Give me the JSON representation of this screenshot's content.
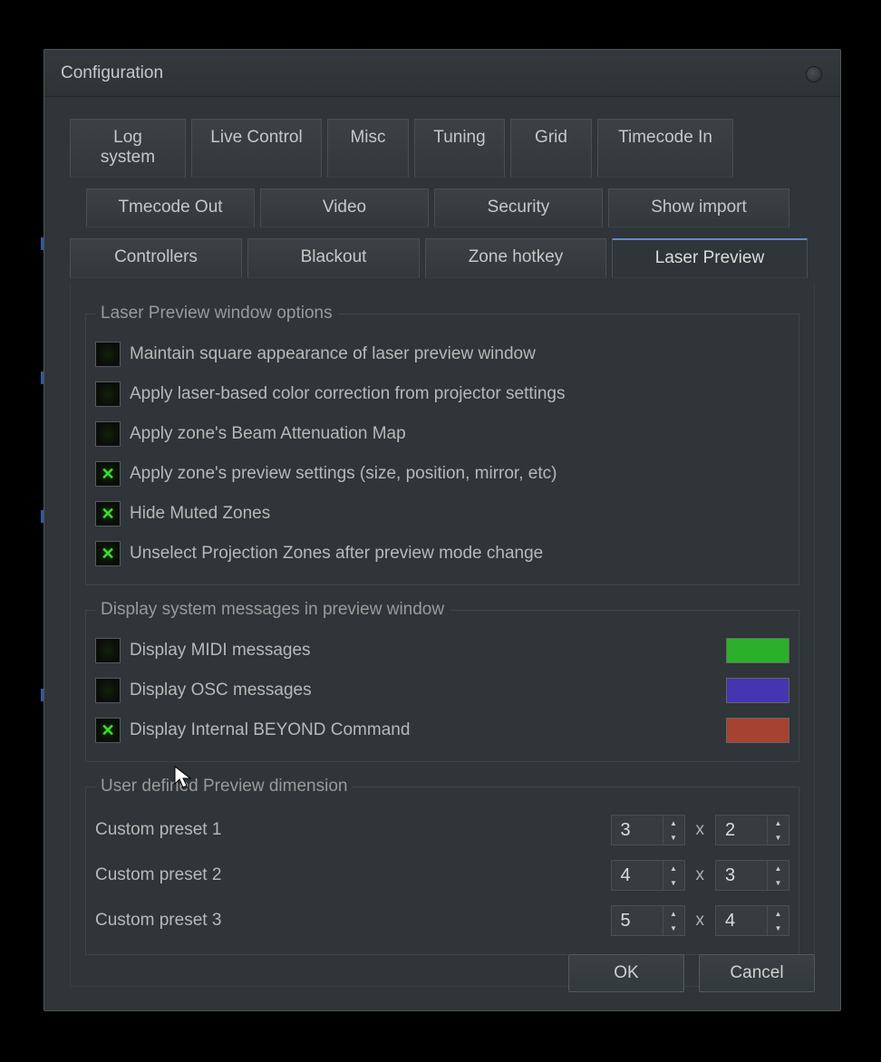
{
  "window": {
    "title": "Configuration"
  },
  "tabs": {
    "row1": [
      "Log system",
      "Live Control",
      "Misc",
      "Tuning",
      "Grid",
      "Timecode In"
    ],
    "row2": [
      "Tmecode Out",
      "Video",
      "Security",
      "Show import"
    ],
    "row3": [
      "Controllers",
      "Blackout",
      "Zone hotkey",
      "Laser Preview"
    ],
    "active": "Laser Preview"
  },
  "group1": {
    "legend": "Laser Preview window options",
    "items": [
      {
        "label": "Maintain square appearance of laser preview window",
        "checked": false
      },
      {
        "label": "Apply laser-based color correction from projector settings",
        "checked": false
      },
      {
        "label": "Apply zone's Beam Attenuation Map",
        "checked": false
      },
      {
        "label": "Apply zone's preview settings (size, position, mirror, etc)",
        "checked": true
      },
      {
        "label": "Hide Muted Zones",
        "checked": true
      },
      {
        "label": "Unselect Projection Zones after preview mode change",
        "checked": true
      }
    ]
  },
  "group2": {
    "legend": "Display system messages in preview window",
    "items": [
      {
        "label": "Display MIDI messages",
        "checked": false,
        "color": "#2cb02c"
      },
      {
        "label": "Display OSC messages",
        "checked": false,
        "color": "#4435b0"
      },
      {
        "label": "Display Internal BEYOND Command",
        "checked": true,
        "color": "#a54232"
      }
    ]
  },
  "group3": {
    "legend": "User defined Preview dimension",
    "presets": [
      {
        "label": "Custom preset 1",
        "w": "3",
        "h": "2"
      },
      {
        "label": "Custom preset 2",
        "w": "4",
        "h": "3"
      },
      {
        "label": "Custom preset 3",
        "w": "5",
        "h": "4"
      }
    ],
    "sep": "x"
  },
  "buttons": {
    "ok": "OK",
    "cancel": "Cancel"
  }
}
